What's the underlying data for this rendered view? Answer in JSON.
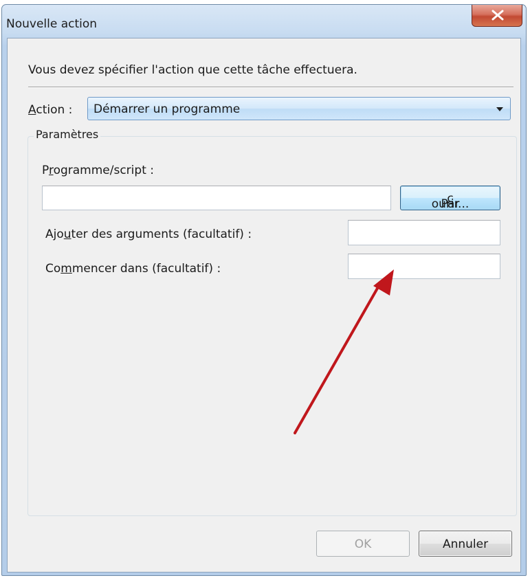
{
  "window": {
    "title": "Nouvelle action",
    "close_icon": "close-icon"
  },
  "instruction": "Vous devez spécifier l'action que cette tâche effectuera.",
  "action": {
    "label_accel": "A",
    "label_rest": "ction :",
    "selected": "Démarrer un programme"
  },
  "parameters": {
    "legend": "Paramètres",
    "program_label_pre": "P",
    "program_label_accel": "r",
    "program_label_post": "ogramme/script :",
    "program_value": "",
    "browse_pre": "Par",
    "browse_accel": "c",
    "browse_post": "ourir...",
    "args_label_pre": "Ajo",
    "args_label_accel": "u",
    "args_label_post": "ter des arguments (facultatif) :",
    "args_value": "",
    "start_label_pre": "Co",
    "start_label_accel": "m",
    "start_label_post": "mencer dans (facultatif) :",
    "start_value": ""
  },
  "footer": {
    "ok": "OK",
    "cancel": "Annuler"
  },
  "colors": {
    "annotation_arrow": "#c0171c"
  }
}
